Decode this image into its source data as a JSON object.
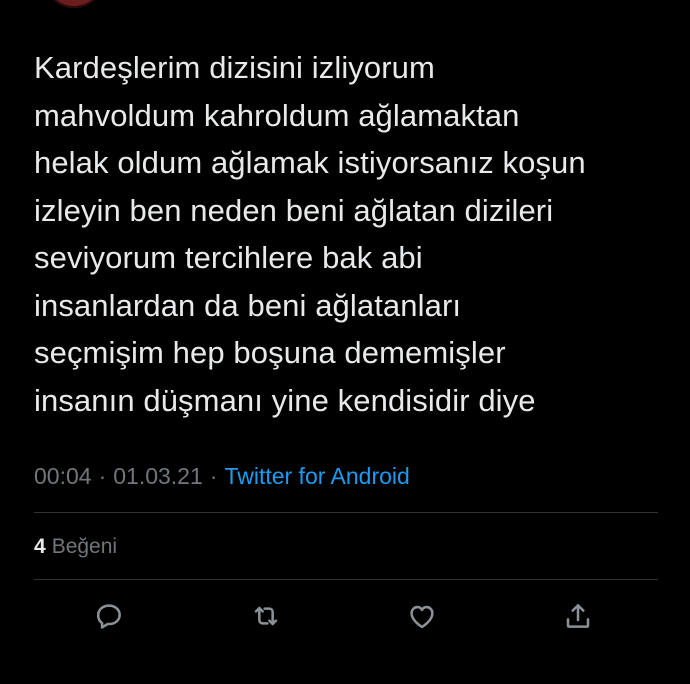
{
  "tweet": {
    "text_lines": [
      "Kardeşlerim dizisini izliyorum",
      "mahvoldum kahroldum ağlamaktan",
      "helak oldum ağlamak istiyorsanız koşun",
      "izleyin ben neden beni ağlatan dizileri",
      "seviyorum tercihlere bak abi",
      "insanlardan da beni ağlatanları",
      "seçmişim hep boşuna dememişler",
      "insanın düşmanı yine kendisidir diye"
    ],
    "time": "00:04",
    "date": "01.03.21",
    "separator": "·",
    "source": "Twitter for Android"
  },
  "engagement": {
    "likes_count": "4",
    "likes_label": "Beğeni"
  },
  "actions": [
    {
      "icon": "reply-icon"
    },
    {
      "icon": "retweet-icon"
    },
    {
      "icon": "heart-icon"
    },
    {
      "icon": "share-icon"
    }
  ],
  "colors": {
    "background": "#000000",
    "text": "#e7e9ea",
    "muted": "#71767b",
    "link": "#1d9bf0",
    "divider": "#2f3336",
    "icon": "#8b9196"
  }
}
